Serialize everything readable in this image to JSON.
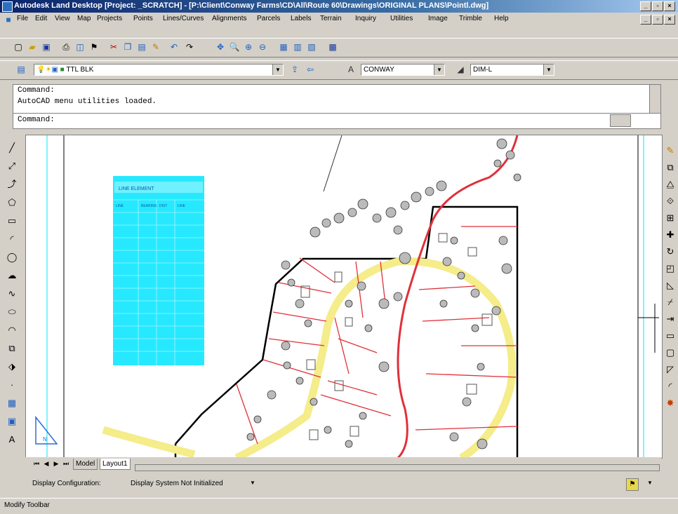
{
  "window": {
    "title": "Autodesk Land Desktop [Project: _SCRATCH] - [P:\\Client\\Conway Farms\\CD\\All\\Route 60\\Drawings\\ORIGINAL PLANS\\Pointl.dwg]",
    "controls": [
      "_",
      "▫",
      "×"
    ]
  },
  "menu": {
    "items": [
      "File",
      "Edit",
      "View",
      "Map",
      "Projects",
      "Points",
      "Lines/Curves",
      "Alignments",
      "Parcels",
      "Labels",
      "Terrain",
      "Inquiry",
      "Utilities",
      "Image",
      "Trimble",
      "Help"
    ]
  },
  "layer_toolbar": {
    "layer_value": "TTL BLK",
    "textstyle_value": "CONWAY",
    "dimstyle_value": "DIM-L"
  },
  "command": {
    "lines": [
      "Command:",
      "AutoCAD menu utilities loaded."
    ],
    "prompt": "Command:"
  },
  "drawing": {
    "table_title": "LINE ELEMENT",
    "table_headers": [
      "LINE",
      "BEARING",
      "DIST",
      "LINE"
    ]
  },
  "tabs": {
    "items": [
      "Model",
      "Layout1"
    ],
    "active": "Layout1"
  },
  "display_config": {
    "label": "Display Configuration:",
    "value": "Display System Not Initialized"
  },
  "status": {
    "text": "Modify Toolbar"
  },
  "colors": {
    "title_start": "#0a246a",
    "title_end": "#a6caf0",
    "chrome": "#d4d0c8",
    "cad_cyan": "#00e5ff",
    "cad_red": "#e0303a",
    "cad_yellow": "#f5ec8a"
  }
}
